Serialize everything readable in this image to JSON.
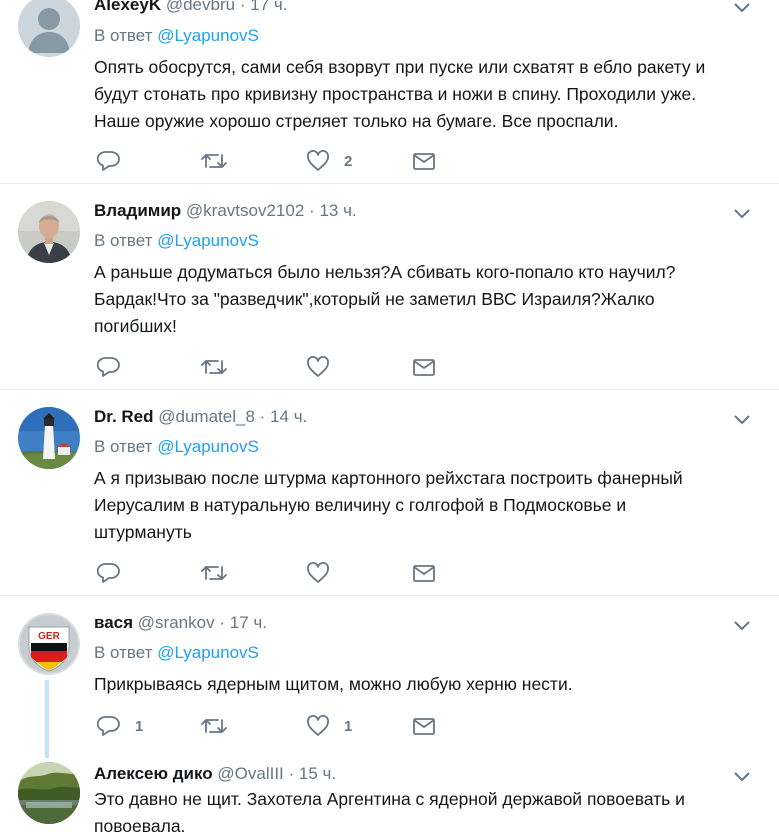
{
  "reply_prefix": "В ответ",
  "tweets": [
    {
      "name": "AlexeyK",
      "handle": "@devbru",
      "time": "17 ч.",
      "reply_to": "@LyapunovS",
      "lines": [
        "Опять обосрутся, сами себя взорвут при пуске или схватят в ебло ракету и",
        "будут стонать про кривизну пространства и ножи в спину. Проходили уже.",
        "Наше оружие хорошо стреляет только на бумаге. Все проспали."
      ],
      "replies": "",
      "retweets": "",
      "likes": "2",
      "avatar": "default-avatar"
    },
    {
      "name": "Владимир",
      "handle": "@kravtsov2102",
      "time": "13 ч.",
      "reply_to": "@LyapunovS",
      "lines": [
        "А раньше додуматься было нельзя?А сбивать кого-попало кто научил?",
        "Бардак!Что за \"разведчик\",который не заметил ВВС Израиля?Жалко",
        "погибших!"
      ],
      "replies": "",
      "retweets": "",
      "likes": "",
      "avatar": "man-photo"
    },
    {
      "name": "Dr. Red",
      "handle": "@dumatel_8",
      "time": "14 ч.",
      "reply_to": "@LyapunovS",
      "lines": [
        "А я призываю после штурма картонного рейхстага построить фанерный",
        "Иерусалим  в натуральную величину с голгофой  в Подмосковье и",
        "штурмануть"
      ],
      "replies": "",
      "retweets": "",
      "likes": "",
      "avatar": "lighthouse-photo"
    },
    {
      "name": "вася",
      "handle": "@srankov",
      "time": "17 ч.",
      "reply_to": "@LyapunovS",
      "lines": [
        "Прикрываясь ядерным щитом, можно любую херню нести."
      ],
      "replies": "1",
      "retweets": "",
      "likes": "1",
      "avatar": "ger-badge",
      "avatar_text": "GER"
    },
    {
      "name": "Алексею дико",
      "handle": "@OvalIII",
      "time": "15 ч.",
      "reply_to": "",
      "lines": [
        "Это давно не щит. Захотела Аргентина с ядерной державой повоевать и",
        "повоевала."
      ],
      "avatar": "landscape-photo"
    }
  ],
  "colors": {
    "link": "#1da1f2",
    "muted": "#657786",
    "text": "#14171a",
    "separator": "#e6ecf0",
    "thread_line": "#bfe4fb"
  }
}
